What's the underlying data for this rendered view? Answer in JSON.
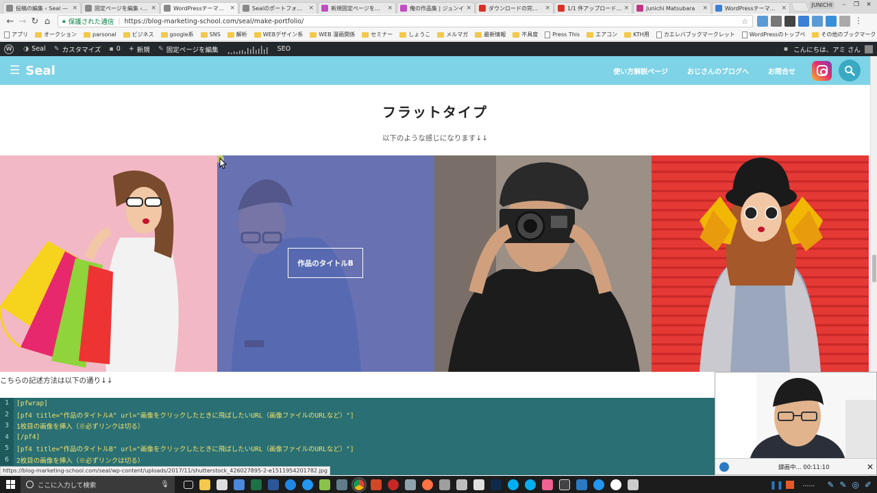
{
  "browser": {
    "tabs": [
      {
        "label": "投稿の編集 ‹ Seal —",
        "color": "#888888"
      },
      {
        "label": "固定ページを編集 ‹ Se",
        "color": "#888888"
      },
      {
        "label": "WordPressテーマ「Seal",
        "color": "#888888"
      },
      {
        "label": "Sealのポートフォリオの",
        "color": "#888888"
      },
      {
        "label": "新規固定ページを追加",
        "color": "#c24cc4"
      },
      {
        "label": "俺の作品集 | ジュンイ",
        "color": "#c24cc4"
      },
      {
        "label": "ダウンロードの完了 - S",
        "color": "#d93025"
      },
      {
        "label": "1/1 件アップロード済み",
        "color": "#d93025"
      },
      {
        "label": "Junichi Matsubara",
        "color": "#c13584"
      },
      {
        "label": "WordPressテーマ「ELE",
        "color": "#3b7fd6"
      }
    ],
    "window_user": "JUNICHI",
    "secure_label": "保護された通信",
    "url": "https://blog-marketing-school.com/seal/make-portfolio/",
    "bookmarks": [
      "アプリ",
      "オークション",
      "parsonal",
      "ビジネス",
      "google系",
      "SNS",
      "解析",
      "WEBデザイン系",
      "WEB 漫画関係",
      "セミナー",
      "しょうこ",
      "メルマガ",
      "最新情報",
      "不具度",
      "Press This",
      "エアコン",
      "KTH用",
      "カエレバブックマークレット",
      "WordPressのトップペ"
    ],
    "other_bookmarks": "その他のブックマーク"
  },
  "adminbar": {
    "site": "Seal",
    "customize": "カスタマイズ",
    "comments": "0",
    "new": "新規",
    "edit": "固定ページを編集",
    "seo": "SEO",
    "greeting": "こんにちは、アミ さん"
  },
  "site": {
    "name": "Seal",
    "nav": [
      "使い方解説ページ",
      "おじさんのブログへ",
      "お問合せ"
    ]
  },
  "page": {
    "section_title": "フラットタイプ",
    "section_sub": "以下のような感じになります↓↓",
    "tiles": [
      {
        "caption": "",
        "bg": "#f3b8c5"
      },
      {
        "caption": "作品のタイトルB",
        "bg": "#6a74b4"
      },
      {
        "caption": "",
        "bg": "#8a8a8a"
      },
      {
        "caption": "",
        "bg": "#e53935"
      }
    ],
    "howto": "こちらの記述方法は以下の通り↓↓",
    "code_lines": [
      {
        "n": "1",
        "text": "[pfwrap]"
      },
      {
        "n": "2",
        "text": "[pf4 title=\"作品のタイトルA\" url=\"画像をクリックしたときに飛ばしたいURL（画像ファイルのURLなど）\"]"
      },
      {
        "n": "3",
        "text": "1枚目の画像を挿入（※必ずリンクは切る）"
      },
      {
        "n": "4",
        "text": "[/pf4]"
      },
      {
        "n": "5",
        "text": "[pf4 title=\"作品のタイトルB\" url=\"画像をクリックしたときに飛ばしたいURL（画像ファイルのURLなど）\"]"
      },
      {
        "n": "6",
        "text": "2枚目の画像を挿入（※必ずリンクは切る）"
      }
    ]
  },
  "status_url": "https://blog-marketing-school.com/seal/wp-content/uploads/2017/11/shutterstock_426027895-2-e1511954201782.jpg",
  "recorder": {
    "label": "録画中... 00:11:10"
  },
  "taskbar": {
    "search_placeholder": "ここに入力して検索"
  }
}
